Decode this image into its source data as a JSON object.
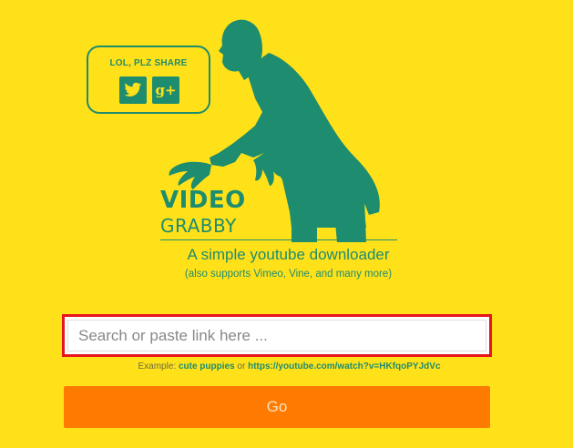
{
  "share": {
    "title": "LOL, PLZ SHARE",
    "twitter_icon": "twitter-icon",
    "gplus_icon": "google-plus-icon",
    "gplus_label": "g+"
  },
  "logo": {
    "line1": "VIDEO",
    "line2": "GRABBY"
  },
  "tagline": "A simple youtube downloader",
  "subtagline": "(also supports Vimeo, Vine, and many more)",
  "search": {
    "placeholder": "Search or paste link here ...",
    "value": ""
  },
  "example": {
    "prefix": "Example:",
    "link1": "cute puppies",
    "or": "or",
    "link2": "https://youtube.com/watch?v=HKfqoPYJdVc"
  },
  "go_button": "Go",
  "colors": {
    "background": "#FFE11A",
    "accent_green": "#1E8C6E",
    "button_orange": "#FF7A00",
    "highlight_red": "#E8141C"
  }
}
